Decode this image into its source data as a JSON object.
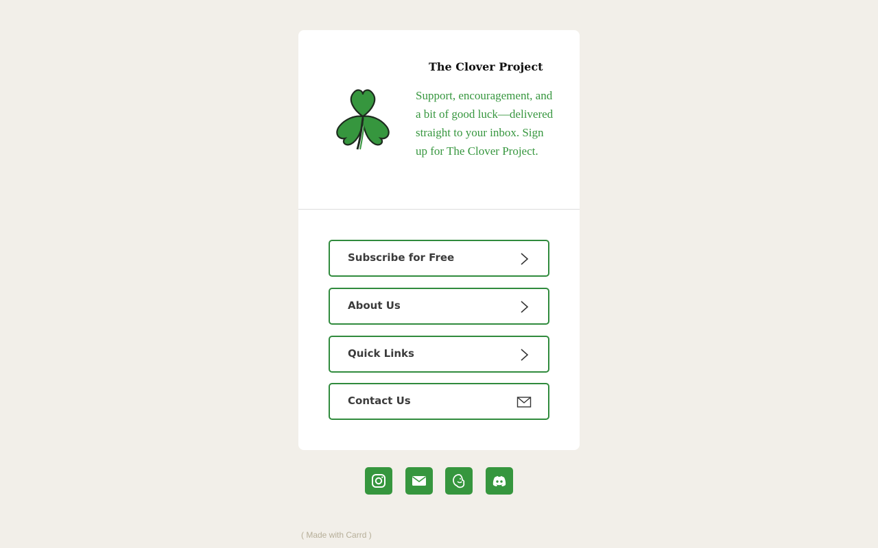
{
  "header": {
    "title": "The Clover Project",
    "description": "Support, encouragement, and a bit of good luck—delivered straight to your inbox. Sign up for The Clover Project."
  },
  "buttons": [
    {
      "label": "Subscribe for Free",
      "icon": "chevron-right-icon"
    },
    {
      "label": "About Us",
      "icon": "chevron-right-icon"
    },
    {
      "label": "Quick Links",
      "icon": "chevron-right-icon"
    },
    {
      "label": "Contact Us",
      "icon": "envelope-icon"
    }
  ],
  "socials": [
    {
      "icon": "instagram-icon"
    },
    {
      "icon": "email-icon"
    },
    {
      "icon": "mailchimp-icon"
    },
    {
      "icon": "discord-icon"
    }
  ],
  "footer": {
    "made_with": "( Made with Carrd )"
  },
  "colors": {
    "accent": "#36963e",
    "button_border": "#2f8a3c",
    "background": "#f2efe9",
    "card": "#ffffff"
  }
}
